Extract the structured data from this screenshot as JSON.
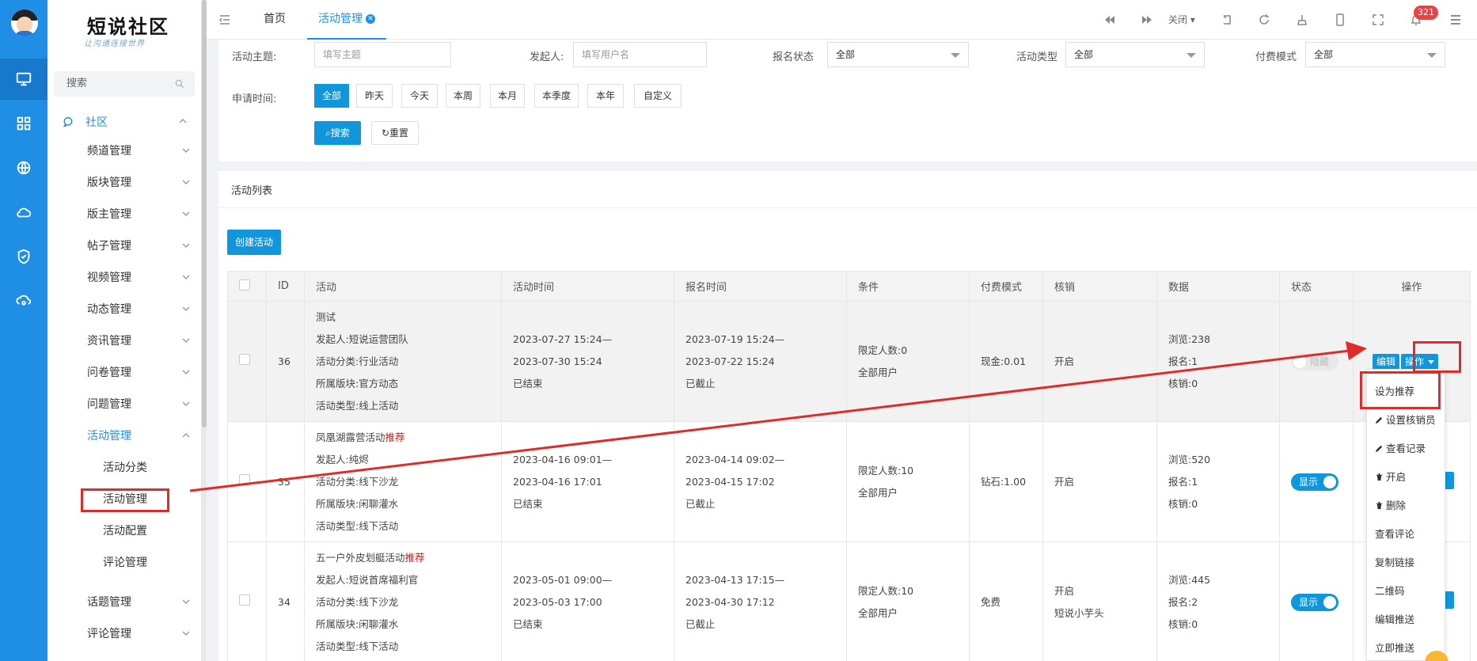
{
  "brand": {
    "title": "短说社区",
    "subtitle": "让沟通连接世界"
  },
  "sidebar": {
    "search_placeholder": "搜索",
    "group": "社区",
    "items": [
      {
        "label": "频道管理"
      },
      {
        "label": "版块管理"
      },
      {
        "label": "版主管理"
      },
      {
        "label": "帖子管理"
      },
      {
        "label": "视频管理"
      },
      {
        "label": "动态管理"
      },
      {
        "label": "资讯管理"
      },
      {
        "label": "问卷管理"
      },
      {
        "label": "问题管理"
      },
      {
        "label": "活动管理"
      }
    ],
    "sub_items": [
      {
        "label": "活动分类"
      },
      {
        "label": "活动管理"
      },
      {
        "label": "活动配置"
      },
      {
        "label": "评论管理"
      }
    ],
    "after_items": [
      {
        "label": "话题管理"
      },
      {
        "label": "评论管理"
      }
    ]
  },
  "header": {
    "tabs": [
      {
        "label": "首页"
      },
      {
        "label": "活动管理"
      }
    ],
    "close_label": "关闭",
    "notification_count": "321"
  },
  "filters": {
    "theme_label": "活动主题:",
    "theme_placeholder": "填写主题",
    "sponsor_label": "发起人:",
    "sponsor_placeholder": "填写用户名",
    "signup_status_label": "报名状态",
    "signup_status_value": "全部",
    "type_label": "活动类型",
    "type_value": "全部",
    "pay_label": "付费模式",
    "pay_value": "全部",
    "time_label": "申请时间:",
    "time_options": [
      "全部",
      "昨天",
      "今天",
      "本周",
      "本月",
      "本季度",
      "本年",
      "自定义"
    ],
    "search_btn": "搜索",
    "reset_btn": "重置"
  },
  "list": {
    "title": "活动列表",
    "create_btn": "创建活动",
    "columns": [
      "ID",
      "活动",
      "活动时间",
      "报名时间",
      "条件",
      "付费模式",
      "核销",
      "数据",
      "状态",
      "操作"
    ],
    "rows": [
      {
        "id": "36",
        "activity": [
          "测试",
          "发起人:短说运营团队",
          "活动分类:行业活动",
          "所属版块:官方动态",
          "活动类型:线上活动"
        ],
        "recommended": "",
        "time": [
          "2023-07-27 15:24—",
          "2023-07-30 15:24",
          "已结束"
        ],
        "signup": [
          "2023-07-19 15:24—",
          "2023-07-22 15:24",
          "已截止"
        ],
        "condition": [
          "限定人数:0",
          "全部用户"
        ],
        "pay": "现金:0.01",
        "verify": [
          "开启"
        ],
        "stats": [
          "浏览:238",
          "报名:1",
          "核销:0"
        ],
        "status": "隐藏"
      },
      {
        "id": "35",
        "activity": [
          "凤凰湖露营活动",
          "发起人:纯烬",
          "活动分类:线下沙龙",
          "所属版块:闲聊灌水",
          "活动类型:线下活动"
        ],
        "recommended": "推荐",
        "time": [
          "2023-04-16 09:01—",
          "2023-04-16 17:01",
          "已结束"
        ],
        "signup": [
          "2023-04-14 09:02—",
          "2023-04-15 17:02",
          "已截止"
        ],
        "condition": [
          "限定人数:10",
          "全部用户"
        ],
        "pay": "钻石:1.00",
        "verify": [
          "开启"
        ],
        "stats": [
          "浏览:520",
          "报名:1",
          "核销:0"
        ],
        "status": "显示"
      },
      {
        "id": "34",
        "activity": [
          "五一户外皮划艇活动",
          "发起人:短说首席福利官",
          "活动分类:线下沙龙",
          "所属版块:闲聊灌水",
          "活动类型:线下活动"
        ],
        "recommended": "推荐",
        "time": [
          "2023-05-01 09:00—",
          "2023-05-03 17:00",
          "已结束"
        ],
        "signup": [
          "2023-04-13 17:15—",
          "2023-04-30 17:12",
          "已截止"
        ],
        "condition": [
          "限定人数:10",
          "全部用户"
        ],
        "pay": "免费",
        "verify": [
          "开启",
          "短说小芋头"
        ],
        "stats": [
          "浏览:445",
          "报名:2",
          "核销:0"
        ],
        "status": "显示"
      }
    ],
    "edit_label": "编辑",
    "ops_label": "操作"
  },
  "dropdown": {
    "items": [
      "设为推荐",
      "设置核销员",
      "查看记录",
      "开启",
      "删除",
      "查看评论",
      "复制链接",
      "二维码",
      "编辑推送",
      "立即推送"
    ]
  },
  "colors": {
    "primary": "#1296db",
    "rail": "#1f8fe5",
    "annotation": "#e12a2a",
    "recommend": "#c81a1a"
  }
}
